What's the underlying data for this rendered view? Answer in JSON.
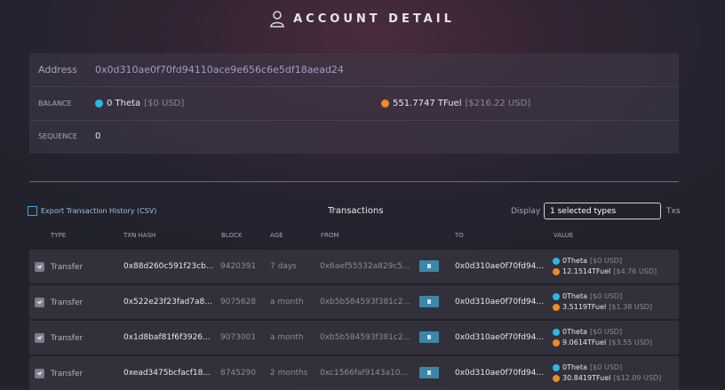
{
  "header": {
    "title": "ACCOUNT DETAIL",
    "icon": "user-icon"
  },
  "account": {
    "address_label": "Address",
    "address": "0x0d310ae0f70fd94110ace9e656c6e5df18aead24",
    "balance_label": "BALANCE",
    "theta_balance": "0 Theta",
    "theta_usd": "[$0 USD]",
    "tfuel_balance": "551.7747 TFuel",
    "tfuel_usd": "[$216.22 USD]",
    "sequence_label": "SEQUENCE",
    "sequence": "0"
  },
  "colors": {
    "theta": "#2ab8e6",
    "tfuel": "#f08a24",
    "arrow": "#3c86a8"
  },
  "toolbar": {
    "export_label": "Export Transaction History (CSV)",
    "transactions_title": "Transactions",
    "display_label": "Display",
    "select_value": "1 selected types",
    "txs_label": "Txs"
  },
  "table": {
    "headers": [
      "TYPE",
      "TXN HASH",
      "BLOCK",
      "AGE",
      "FROM",
      "TO",
      "VALUE"
    ],
    "rows": [
      {
        "type": "Transfer",
        "hash": "0x88d260c591f23cb...",
        "block": "9420391",
        "age": "7 days",
        "from": "0x6aef55532a829c5...",
        "to": "0x0d310ae0f70fd94...",
        "theta": "0Theta",
        "theta_usd": "[$0 USD]",
        "tfuel": "12.1514TFuel",
        "tfuel_usd": "[$4.76 USD]"
      },
      {
        "type": "Transfer",
        "hash": "0x522e23f23fad7a8...",
        "block": "9075628",
        "age": "a month",
        "from": "0xb5b584593f381c2...",
        "to": "0x0d310ae0f70fd94...",
        "theta": "0Theta",
        "theta_usd": "[$0 USD]",
        "tfuel": "3.5119TFuel",
        "tfuel_usd": "[$1.38 USD]"
      },
      {
        "type": "Transfer",
        "hash": "0x1d8baf81f6f3926...",
        "block": "9073001",
        "age": "a month",
        "from": "0xb5b584593f381c2...",
        "to": "0x0d310ae0f70fd94...",
        "theta": "0Theta",
        "theta_usd": "[$0 USD]",
        "tfuel": "9.0614TFuel",
        "tfuel_usd": "[$3.55 USD]"
      },
      {
        "type": "Transfer",
        "hash": "0xead3475bcfacf18...",
        "block": "8745290",
        "age": "2 months",
        "from": "0xc1566faf9143a10...",
        "to": "0x0d310ae0f70fd94...",
        "theta": "0Theta",
        "theta_usd": "[$0 USD]",
        "tfuel": "30.8419TFuel",
        "tfuel_usd": "[$12.09 USD]"
      }
    ]
  }
}
